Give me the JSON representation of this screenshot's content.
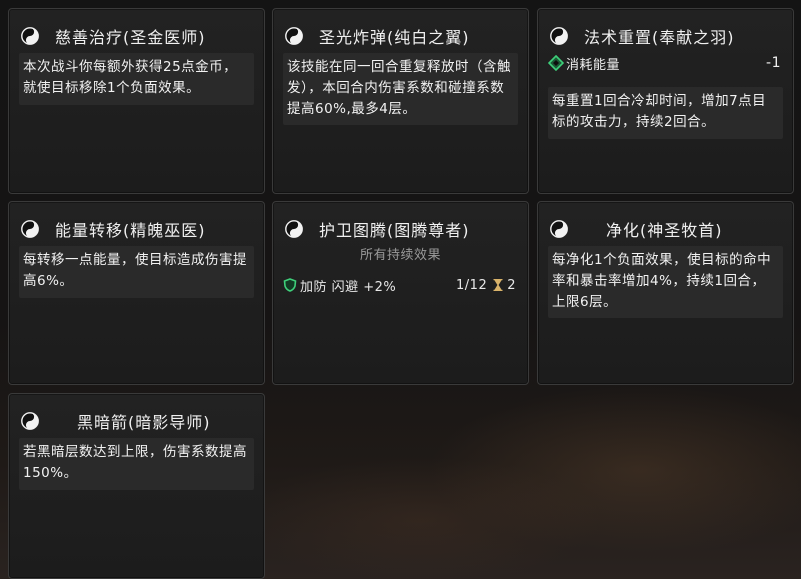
{
  "cards": [
    {
      "title": "慈善治疗(圣金医师)",
      "description": "本次战斗你每额外获得25点金币，就使目标移除1个负面效果。"
    },
    {
      "title": "圣光炸弹(纯白之翼)",
      "description": "该技能在同一回合重复释放时（含触发），本回合内伤害系数和碰撞系数提高60%,最多4层。"
    },
    {
      "title": "法术重置(奉献之羽)",
      "cost_label": "消耗能量",
      "cost_value": "-1",
      "description": "每重置1回合冷却时间，增加7点目标的攻击力，持续2回合。"
    },
    {
      "title": "能量转移(精魄巫医)",
      "description": "每转移一点能量，使目标造成伤害提高6%。"
    },
    {
      "title": "护卫图腾(图腾尊者)",
      "effects_header": "所有持续效果",
      "effect_name": "加防 闪避 +2%",
      "effect_stack": "1/12",
      "effect_turns": "2"
    },
    {
      "title": "净化(神圣牧首)",
      "description": "每净化1个负面效果，使目标的命中率和暴击率增加4%，持续1回合，上限6层。"
    },
    {
      "title": "黑暗箭(暗影导师)",
      "description": "若黑暗层数达到上限，伤害系数提高150%。"
    }
  ],
  "icons": {
    "card_icon": "yin-yang-icon",
    "cost_icon": "green-diamond-icon",
    "effect_icon": "green-shield-icon",
    "duration_icon": "hourglass-icon"
  },
  "colors": {
    "accent_green": "#3ecf7a",
    "hourglass_gold": "#d9b36a"
  }
}
